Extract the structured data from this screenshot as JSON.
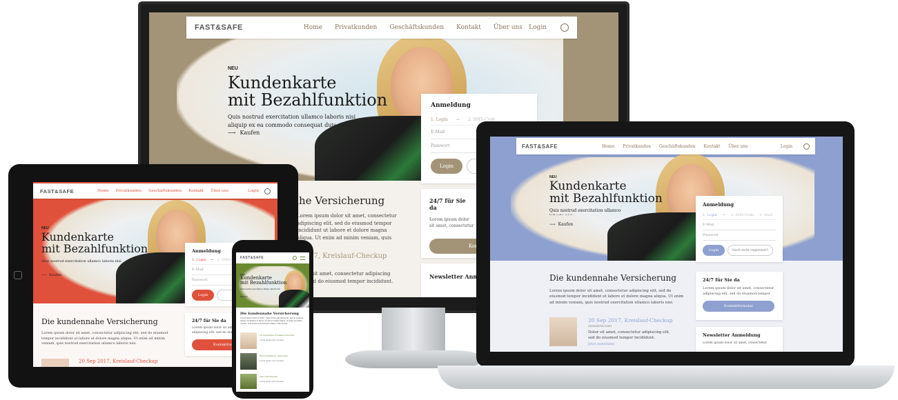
{
  "site": {
    "logo": "FAST&SAFE",
    "nav": [
      "Home",
      "Privatkunden",
      "Geschäftskunden",
      "Kontakt",
      "Über uns"
    ],
    "login": "Login",
    "search_icon": "search-icon"
  },
  "hero": {
    "tag": "NEU",
    "title_line1": "Kundenkarte",
    "title_line2": "mit Bezahlfunktion",
    "text_line1": "Quis nostrud exercitation ullamco laboris nisi",
    "text_line2": "aliquip ex ea commodo consequat duis aute.",
    "cta": "Kaufen"
  },
  "login_card": {
    "title": "Anmeldung",
    "step1": "1. Login",
    "step2": "2. SMS-Code",
    "step3": "3. Start",
    "email_placeholder": "E-Mail",
    "password_placeholder": "Passwort",
    "login_button": "Login",
    "register_button": "Noch nicht registriert?"
  },
  "section": {
    "title": "Die kundennahe Versicherung",
    "title_partial": "ahe Versicherung",
    "text": "Lorem ipsum dolor sit amet, consectetur adipiscing elit, sed do eiusmod tempor incididunt ut labore et dolore magna aliqua. Ut enim ad minim veniam, quis nostrud exercitation ullamco laboris nisi."
  },
  "service_card": {
    "title": "24/7 für Sie da",
    "text": "Lorem ipsum dolor sit amet, consectetur adipiscing elit, sed do eiusmod tempor incididunt.",
    "button": "Kontaktformular",
    "button_partial": "Kontak"
  },
  "newsletter": {
    "title": "Newsletter Anmeldung",
    "title_partial": "Newsletter Anme",
    "text": "Lorem ipsum dolor sit amet, consectetur"
  },
  "event": {
    "date_title": "20 Sep 2017, Kreislauf-Checkup",
    "date_partial": "17, Kreislauf-Checkup",
    "category": "VERANSTALTUNG",
    "text": "Dolor sit amet, consectetur adipiscing elit, sed do eiusmod tempor incididunt.",
    "link": "Jetzt anmelden"
  },
  "phone_items": [
    {
      "title": "20 September Kreislauf-Checkup",
      "text": "Lorem ipsum dolor sit amet"
    },
    {
      "title": "Motorradfahrer unterwegs",
      "text": "Lorem ipsum dolor sit amet"
    },
    {
      "title": "Jetzt informieren",
      "text": "Lorem ipsum dolor sit amet"
    }
  ],
  "colors": {
    "monitor_accent": "#a39478",
    "laptop_accent": "#8ea0cf",
    "tablet_accent": "#e0513c",
    "phone_accent": "#6b8a32",
    "nav_text": "#8b7358"
  }
}
